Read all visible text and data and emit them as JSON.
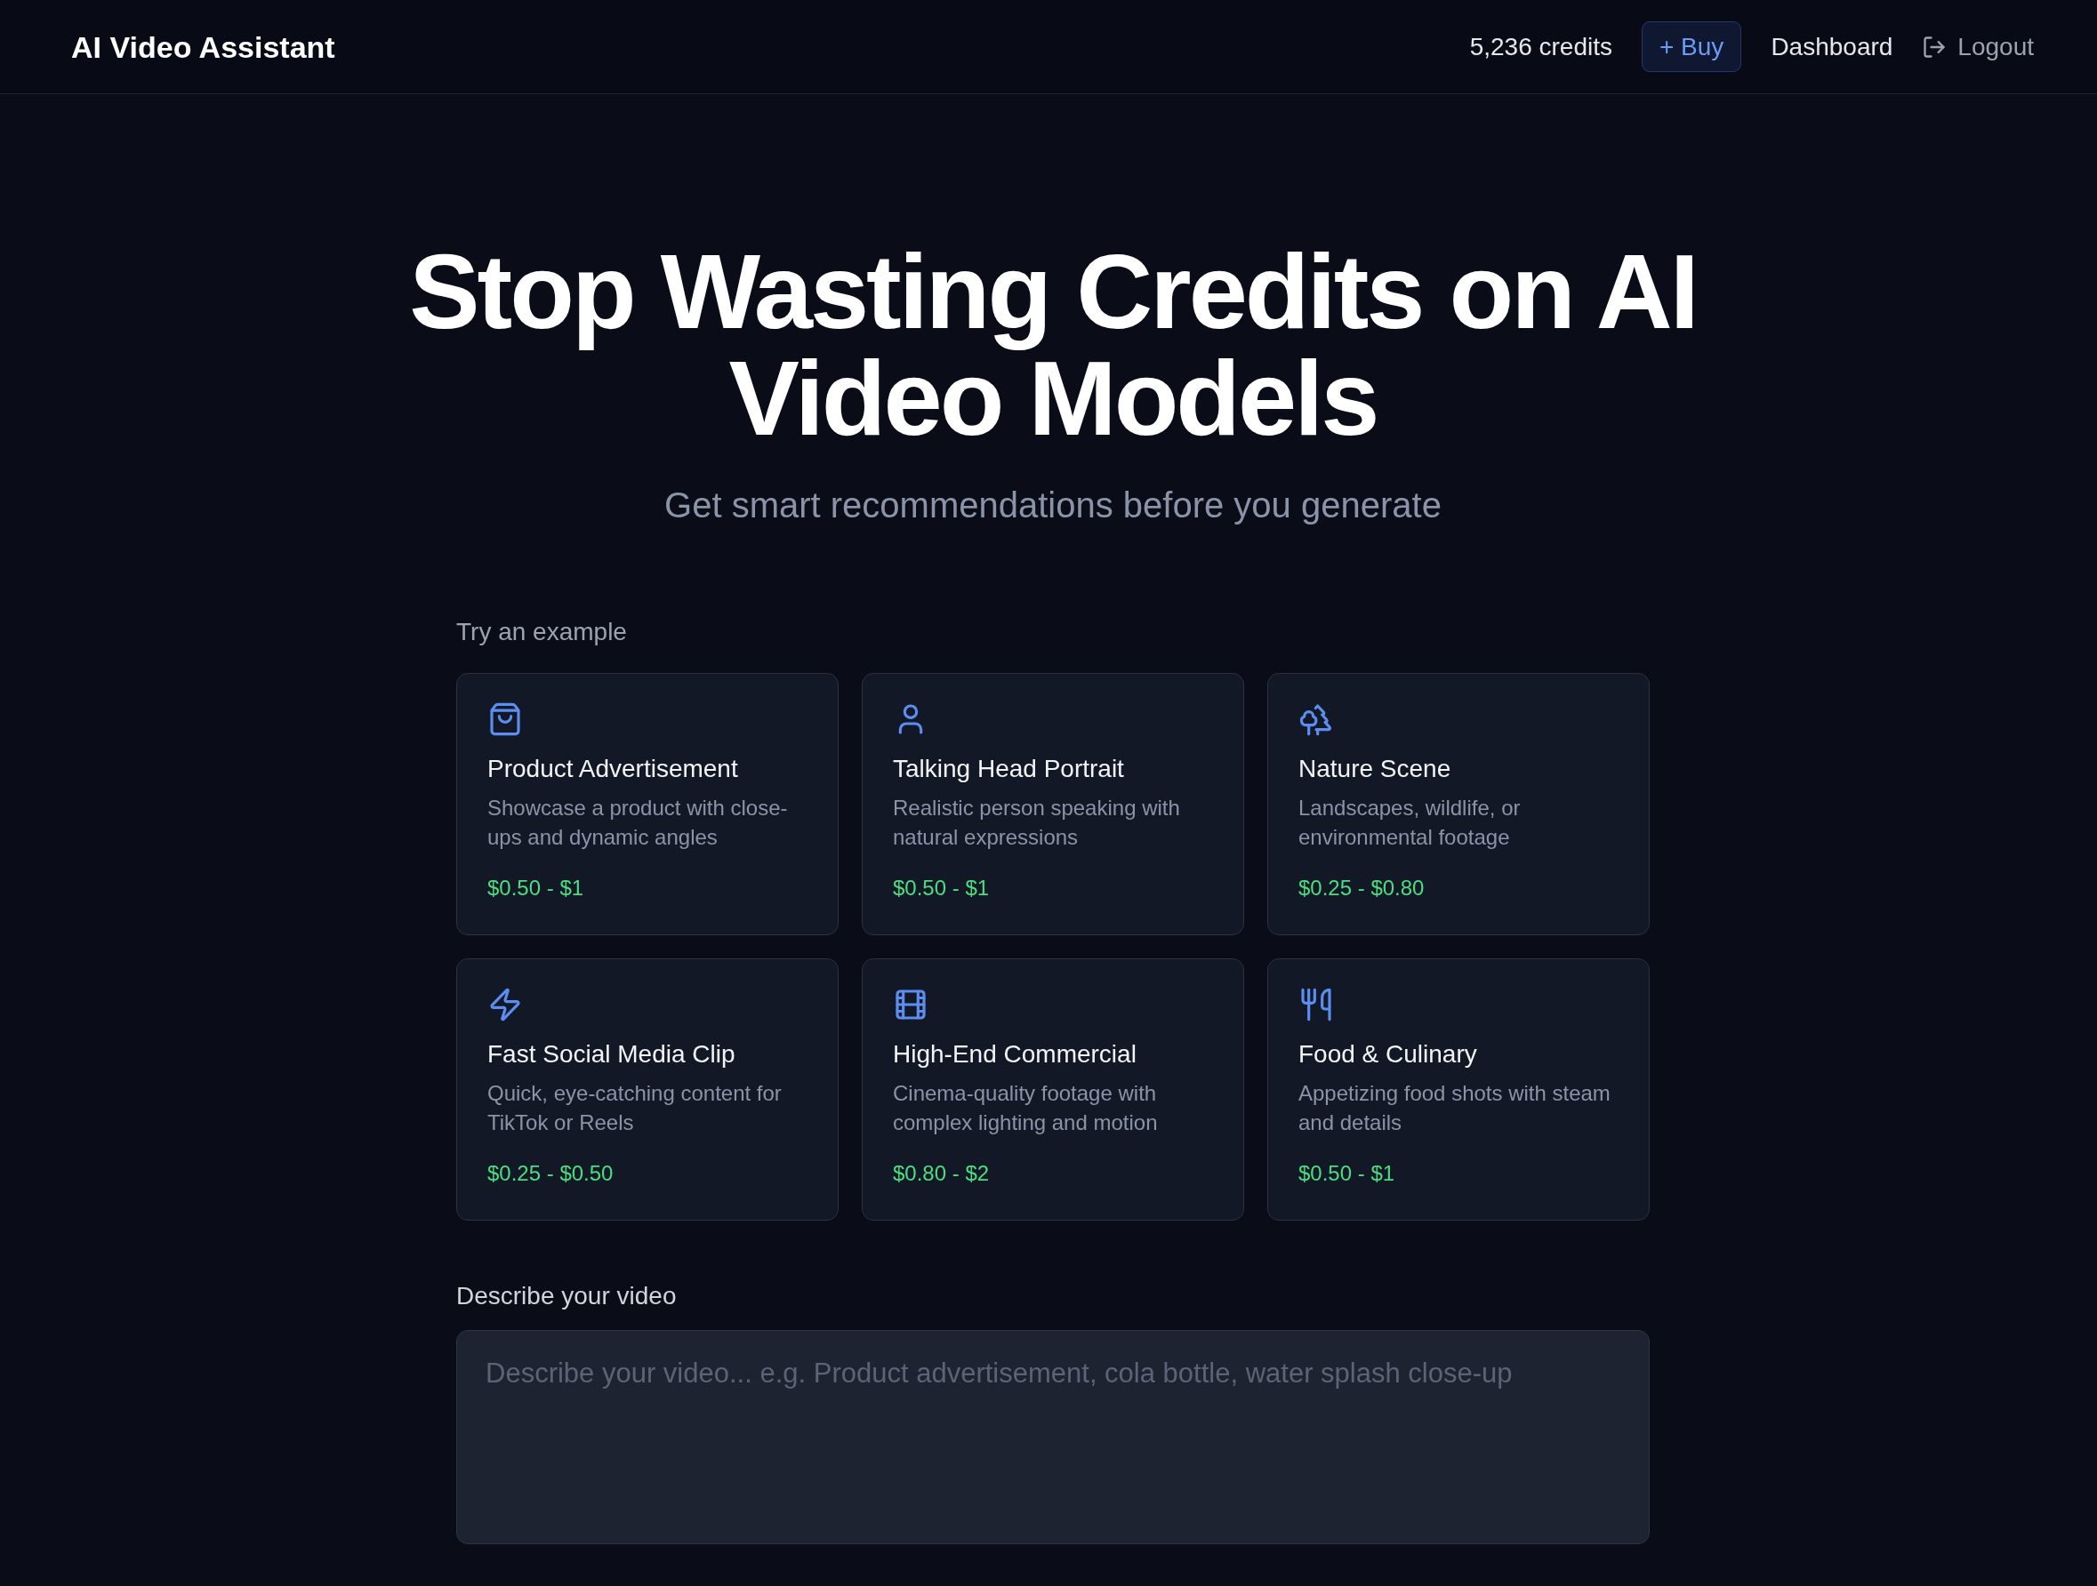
{
  "header": {
    "logo": "AI Video Assistant",
    "credits": "5,236 credits",
    "buy_button": "+ Buy",
    "nav": [
      {
        "kind": "link",
        "label": "Dashboard"
      },
      {
        "kind": "logout",
        "label": "Logout"
      }
    ]
  },
  "hero": {
    "title": "Stop Wasting Credits on AI Video Models",
    "subtitle": "Get smart recommendations before you generate"
  },
  "examples": {
    "label": "Try an example",
    "cards": [
      {
        "title": "Product Advertisement",
        "description": "Showcase a product with close-ups and dynamic angles",
        "price": "$0.50 - $1"
      },
      {
        "title": "Talking Head Portrait",
        "description": "Realistic person speaking with natural expressions",
        "price": "$0.50 - $1"
      },
      {
        "title": "Nature Scene",
        "description": "Landscapes, wildlife, or environmental footage",
        "price": "$0.25 - $0.80"
      },
      {
        "title": "Fast Social Media Clip",
        "description": "Quick, eye-catching content for TikTok or Reels",
        "price": "$0.25 - $0.50"
      },
      {
        "title": "High-End Commercial",
        "description": "Cinema-quality footage with complex lighting and motion",
        "price": "$0.80 - $2"
      },
      {
        "title": "Food & Culinary",
        "description": "Appetizing food shots with steam and details",
        "price": "$0.50 - $1"
      }
    ]
  },
  "prompt": {
    "label": "Describe your video",
    "placeholder": "Describe your video... e.g. Product advertisement, cola bottle, water splash close-up"
  }
}
